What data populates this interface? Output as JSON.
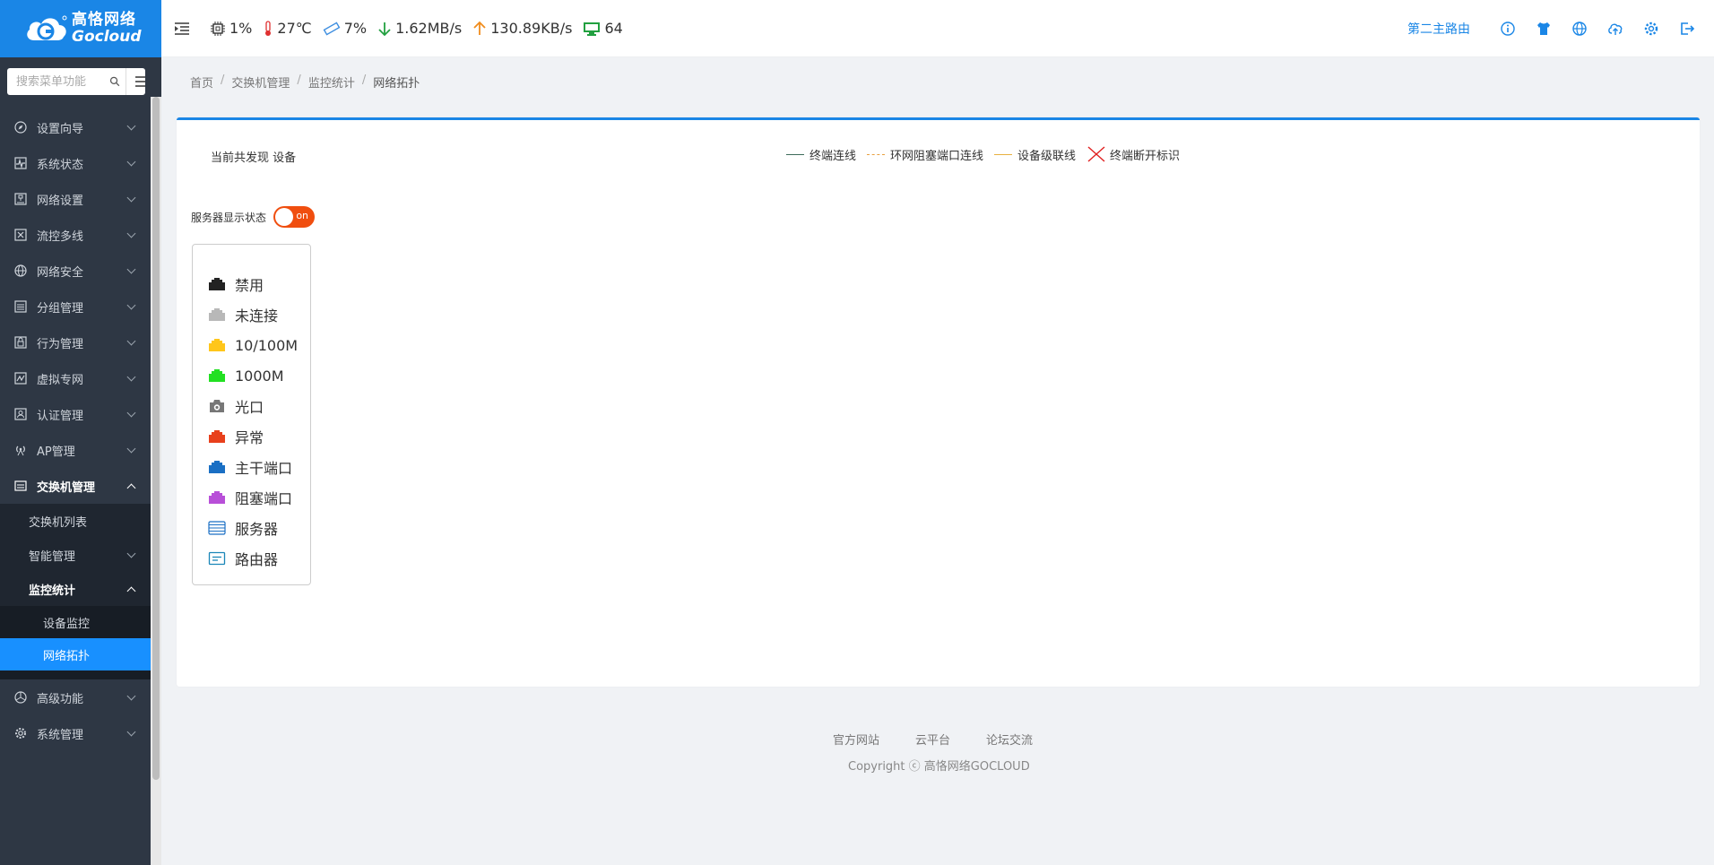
{
  "logo": {
    "cn": "高恪网络",
    "en": "Gocloud"
  },
  "search": {
    "placeholder": "搜索菜单功能"
  },
  "nav": {
    "items": [
      {
        "label": "设置向导",
        "icon": "compass-icon"
      },
      {
        "label": "系统状态",
        "icon": "pulse-icon"
      },
      {
        "label": "网络设置",
        "icon": "network-icon"
      },
      {
        "label": "流控多线",
        "icon": "flow-icon"
      },
      {
        "label": "网络安全",
        "icon": "globe-icon"
      },
      {
        "label": "分组管理",
        "icon": "group-icon"
      },
      {
        "label": "行为管理",
        "icon": "behavior-icon"
      },
      {
        "label": "虚拟专网",
        "icon": "vpn-icon"
      },
      {
        "label": "认证管理",
        "icon": "auth-icon"
      },
      {
        "label": "AP管理",
        "icon": "antenna-icon"
      },
      {
        "label": "交换机管理",
        "icon": "switch-icon"
      }
    ],
    "switch_sub": {
      "list": "交换机列表",
      "smart": "智能管理",
      "monitor": "监控统计",
      "device_monitor": "设备监控",
      "topology": "网络拓扑"
    },
    "bottom_items": [
      {
        "label": "高级功能",
        "icon": "advanced-icon"
      },
      {
        "label": "系统管理",
        "icon": "gear-icon"
      }
    ]
  },
  "header": {
    "cpu": "1%",
    "temp": "27℃",
    "mem": "7%",
    "down": "1.62MB/s",
    "up": "130.89KB/s",
    "clients": "64",
    "router_name": "第二主路由"
  },
  "breadcrumb": [
    "首页",
    "交换机管理",
    "监控统计",
    "网络拓扑"
  ],
  "panel": {
    "found_text": "当前共发现  设备",
    "line_legend": [
      {
        "label": "终端连线",
        "color": "#3d6b5a",
        "style": "solid"
      },
      {
        "label": "环网阻塞端口连线",
        "color": "#e8a040",
        "style": "dashed"
      },
      {
        "label": "设备级联线",
        "color": "#e8b040",
        "style": "solid"
      },
      {
        "label": "终端断开标识",
        "color": "#e02020",
        "style": "cross"
      }
    ],
    "server_toggle_label": "服务器显示状态",
    "server_toggle_value": "on",
    "port_legend": [
      {
        "label": "禁用",
        "color": "#222222",
        "icon": "port-icon"
      },
      {
        "label": "未连接",
        "color": "#b8b8b8",
        "icon": "port-icon"
      },
      {
        "label": "10/100M",
        "color": "#ffc61a",
        "icon": "port-icon"
      },
      {
        "label": "1000M",
        "color": "#22e022",
        "icon": "port-icon"
      },
      {
        "label": "光口",
        "color": "#777777",
        "icon": "fiber-port-icon"
      },
      {
        "label": "异常",
        "color": "#e8401c",
        "icon": "port-icon"
      },
      {
        "label": "主干端口",
        "color": "#1a6fc4",
        "icon": "port-icon"
      },
      {
        "label": "阻塞端口",
        "color": "#b84fd8",
        "icon": "port-icon"
      },
      {
        "label": "服务器",
        "color": "#1a6fc4",
        "icon": "server-icon"
      },
      {
        "label": "路由器",
        "color": "#1a86b8",
        "icon": "router-icon"
      }
    ]
  },
  "footer": {
    "links": [
      "官方网站",
      "云平台",
      "论坛交流"
    ],
    "copyright": "Copyright ⓒ 高恪网络GOCLOUD"
  }
}
